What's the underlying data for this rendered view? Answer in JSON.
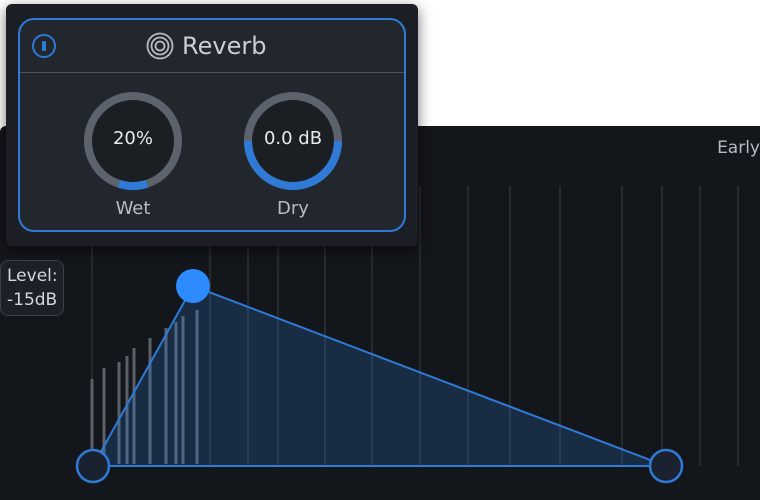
{
  "module": {
    "title": "Reverb",
    "power_on": true,
    "knobs": [
      {
        "name": "wet",
        "value_text": "20%",
        "label": "Wet",
        "fill": 0.1
      },
      {
        "name": "dry",
        "value_text": "0.0 dB",
        "label": "Dry",
        "fill": 0.5
      }
    ]
  },
  "editor": {
    "section_label": "Early",
    "level_label": "Level:",
    "level_value": "-15dB"
  },
  "icons": {
    "power": "power-icon",
    "reverb": "concentric-rings-icon"
  },
  "colors": {
    "accent": "#2f7ad6",
    "node_fill": "#2e8bff",
    "panel_bg": "#22262d",
    "editor_bg": "#13161b"
  }
}
